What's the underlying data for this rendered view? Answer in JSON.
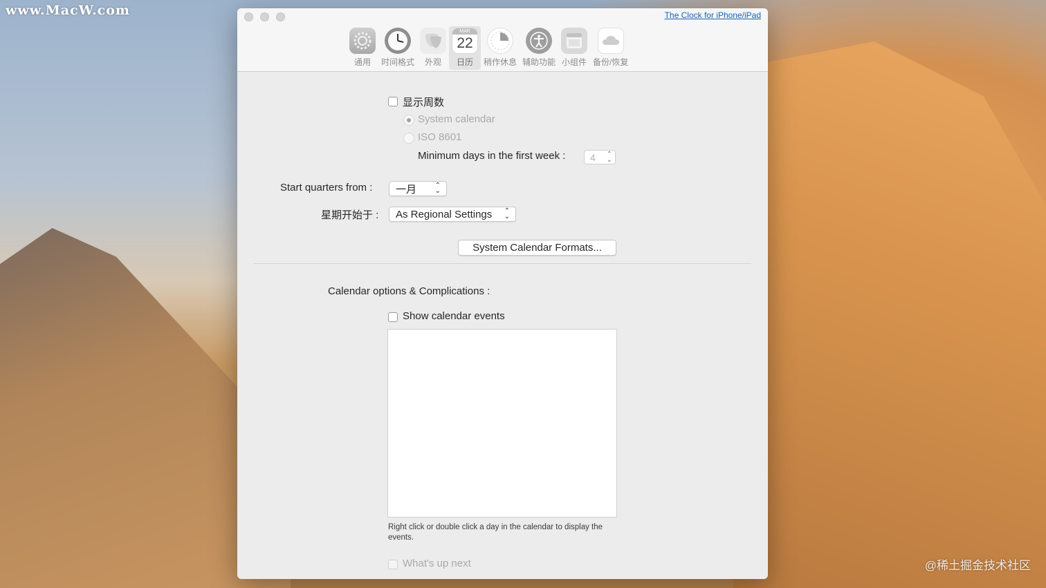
{
  "watermarks": {
    "top_left": "www.MacW.com",
    "bottom_right": "@稀土掘金技术社区"
  },
  "window": {
    "top_link": "The Clock for iPhone/iPad",
    "tabs": [
      {
        "label": "通用",
        "icon": "gear-icon"
      },
      {
        "label": "时间格式",
        "icon": "clock-icon"
      },
      {
        "label": "外观",
        "icon": "masks-icon"
      },
      {
        "label": "日历",
        "icon": "calendar-icon",
        "active": true,
        "month": "MAR",
        "day": "22"
      },
      {
        "label": "稍作休息",
        "icon": "pie-timer-icon"
      },
      {
        "label": "辅助功能",
        "icon": "accessibility-icon"
      },
      {
        "label": "小组件",
        "icon": "widget-icon"
      },
      {
        "label": "备份/恢复",
        "icon": "cloud-icon"
      }
    ]
  },
  "calendar": {
    "show_week_numbers_label": "显示周数",
    "system_calendar_label": "System calendar",
    "iso_label": "ISO 8601",
    "min_days_label": "Minimum days in the first week :",
    "min_days_value": "4",
    "start_quarters_label": "Start quarters from :",
    "start_quarters_value": "一月",
    "week_starts_label": "星期开始于 :",
    "week_starts_value": "As Regional Settings",
    "system_formats_button": "System Calendar Formats...",
    "options_heading": "Calendar options & Complications :",
    "show_events_label": "Show calendar events",
    "help_text": "Right click or double click a day in the calendar to display the events.",
    "whats_up_label": "What's up next"
  }
}
